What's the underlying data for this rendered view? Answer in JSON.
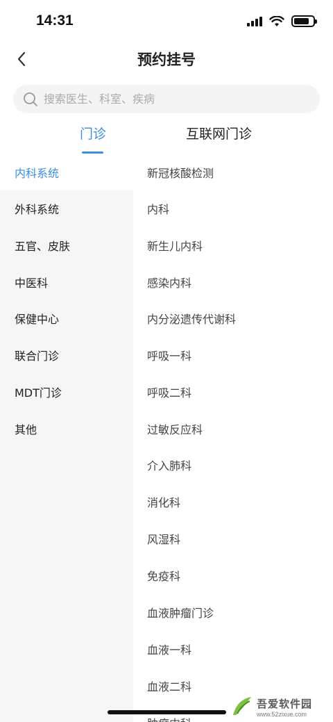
{
  "status_bar": {
    "time": "14:31"
  },
  "nav": {
    "title": "预约挂号"
  },
  "search": {
    "placeholder": "搜索医生、科室、疾病"
  },
  "tabs": [
    {
      "label": "门诊",
      "active": true
    },
    {
      "label": "互联网门诊",
      "active": false
    }
  ],
  "left_menu": {
    "items": [
      {
        "label": "内科系统",
        "active": true
      },
      {
        "label": "外科系统"
      },
      {
        "label": "五官、皮肤"
      },
      {
        "label": "中医科"
      },
      {
        "label": "保健中心"
      },
      {
        "label": "联合门诊"
      },
      {
        "label": "MDT门诊"
      },
      {
        "label": "其他"
      }
    ]
  },
  "departments": {
    "items": [
      "新冠核酸检测",
      "内科",
      "新生儿内科",
      "感染内科",
      "内分泌遗传代谢科",
      "呼吸一科",
      "呼吸二科",
      "过敏反应科",
      "介入肺科",
      "消化科",
      "风湿科",
      "免疫科",
      "血液肿瘤门诊",
      "血液一科",
      "血液二科",
      "肿瘤内科"
    ]
  },
  "watermark": {
    "name": "吾爱软件园",
    "url": "www.52zixue.com"
  },
  "colors": {
    "accent": "#3a8ee6",
    "sidebar_bg": "#f6f6f6",
    "search_bg": "#f4f4f4"
  },
  "icons": {
    "back": "chevron-left-icon",
    "search": "search-icon",
    "signal": "signal-icon",
    "wifi": "wifi-icon",
    "battery": "battery-icon"
  }
}
